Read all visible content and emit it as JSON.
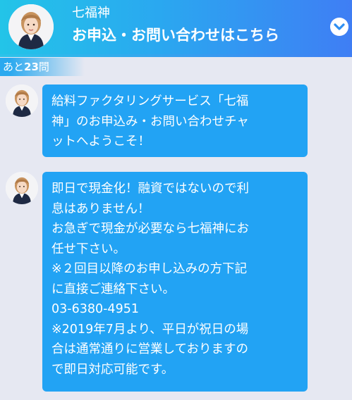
{
  "header": {
    "shop_name": "七福神",
    "title": "お申込・お問い合わせはこちら",
    "toggle_icon": "chevron-down-icon"
  },
  "progress": {
    "prefix": "あと",
    "count": "23",
    "suffix": "問"
  },
  "messages": [
    {
      "sender_icon": "operator-avatar",
      "lines": [
        "給料ファクタリングサービス「七福",
        "神」のお申込み・お問い合わせチャ",
        "ットへようこそ！"
      ]
    },
    {
      "sender_icon": "operator-avatar",
      "lines": [
        "即日で現金化！融資ではないので利",
        "息はありません！",
        "お急ぎで現金が必要なら七福神にお",
        "任せ下さい。",
        "※２回目以降のお申し込みの方下記",
        "に直接ご連絡下さい。",
        "03-6380-4951",
        "※2019年7月より、平日が祝日の場",
        "合は通常通りに営業しておりますの",
        "で即日対応可能です。"
      ]
    }
  ],
  "colors": {
    "header_gradient_start": "#23c4e8",
    "header_gradient_end": "#3f7ef4",
    "bubble": "#22a3f4",
    "background": "#e6e8f2",
    "text_on_accent": "#ffffff"
  }
}
